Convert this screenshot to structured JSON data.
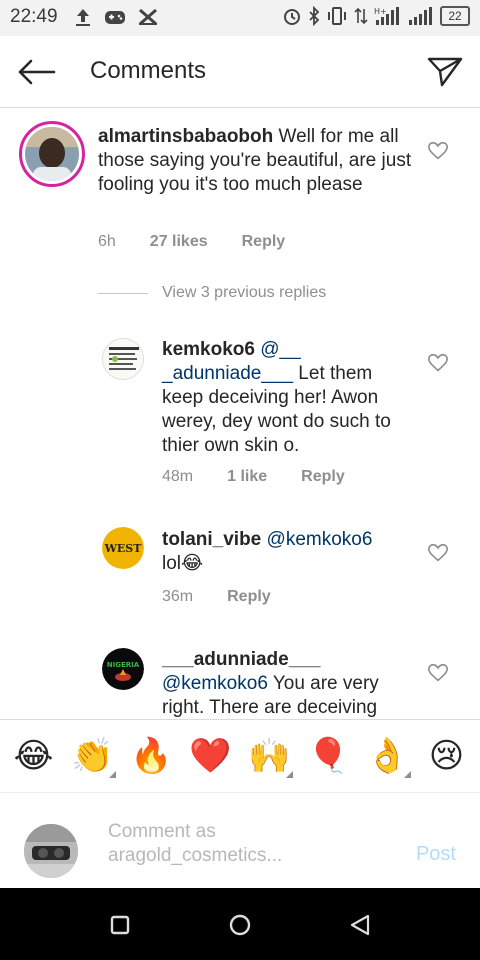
{
  "status_bar": {
    "time": "22:49",
    "battery": "22",
    "icons_left": [
      "upload-icon",
      "gamepad-icon",
      "x-app-icon"
    ],
    "icons_right": [
      "alarm-icon",
      "bluetooth-icon",
      "vibrate-icon",
      "data-icon",
      "signal-icon",
      "signal-icon",
      "battery-icon"
    ]
  },
  "header": {
    "title": "Comments",
    "back_icon": "back-arrow-icon",
    "send_icon": "direct-send-icon"
  },
  "comments": [
    {
      "username": "almartinsbabaoboh",
      "text": " Well for me all those saying you're beautiful, are just fooling you it's too much please",
      "time": "6h",
      "likes": "27 likes",
      "reply": "Reply"
    }
  ],
  "view_replies": "View 3 previous replies",
  "replies": [
    {
      "username": "kemkoko6",
      "mention": "@___adunniade___",
      "mention_line1": "@__",
      "mention_line2": "_adunniade___",
      "text": " Let them keep deceiving her! Awon werey, dey wont do such to thier own skin o.",
      "time": "48m",
      "likes": "1 like",
      "reply": "Reply"
    },
    {
      "username": "tolani_vibe",
      "mention": "@kemkoko6",
      "text": "lol😂",
      "time": "36m",
      "reply": "Reply"
    },
    {
      "username": "___adunniade___",
      "mention": "@kemkoko6",
      "text": " You are very right. There are deceiving"
    }
  ],
  "emoji_bar": [
    "😂",
    "👏",
    "🔥",
    "❤️",
    "🙌",
    "🎈",
    "👌",
    "😢"
  ],
  "comment_input": {
    "placeholder_line1": "Comment as",
    "placeholder_line2": "aragold_cosmetics...",
    "post": "Post"
  },
  "colors": {
    "mention": "#003569",
    "meta": "#8e8e8e",
    "post_disabled": "#b3dbff",
    "heart": "#8e8e8e"
  }
}
